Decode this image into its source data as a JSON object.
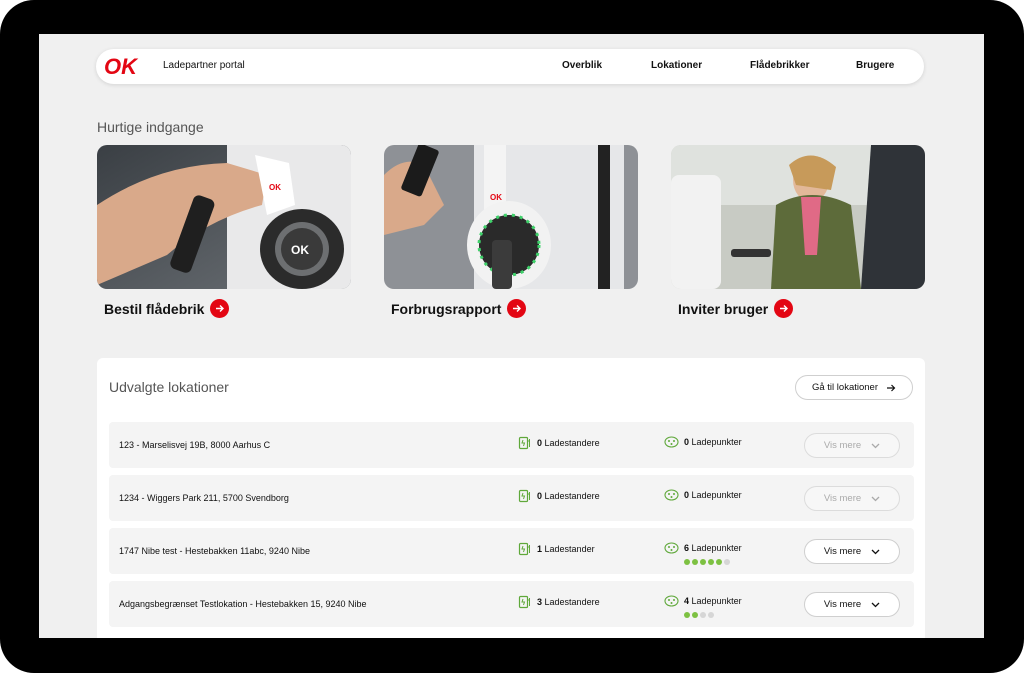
{
  "header": {
    "logo_text": "OK",
    "portal_name": "Ladepartner portal",
    "nav": [
      "Overblik",
      "Lokationer",
      "Flådebrikker",
      "Brugere"
    ]
  },
  "quick": {
    "heading": "Hurtige indgange",
    "cards": [
      {
        "label": "Bestil flådebrik"
      },
      {
        "label": "Forbrugsrapport"
      },
      {
        "label": "Inviter bruger"
      }
    ]
  },
  "locations": {
    "title": "Udvalgte lokationer",
    "goto_label": "Gå til lokationer",
    "rows": [
      {
        "name": "123 - Marselisvej 19B, 8000 Aarhus C",
        "chargers_count": "0",
        "chargers_label": "Ladestandere",
        "points_count": "0",
        "points_label": "Ladepunkter",
        "dots_on": 0,
        "dots_total": 0,
        "button": "Vis mere",
        "enabled": false
      },
      {
        "name": "1234 - Wiggers Park 211, 5700 Svendborg",
        "chargers_count": "0",
        "chargers_label": "Ladestandere",
        "points_count": "0",
        "points_label": "Ladepunkter",
        "dots_on": 0,
        "dots_total": 0,
        "button": "Vis mere",
        "enabled": false
      },
      {
        "name": "1747 Nibe test - Hestebakken 11abc, 9240 Nibe",
        "chargers_count": "1",
        "chargers_label": "Ladestander",
        "points_count": "6",
        "points_label": "Ladepunkter",
        "dots_on": 5,
        "dots_total": 6,
        "button": "Vis mere",
        "enabled": true
      },
      {
        "name": "Adgangsbegrænset Testlokation - Hestebakken 15, 9240 Nibe",
        "chargers_count": "3",
        "chargers_label": "Ladestandere",
        "points_count": "4",
        "points_label": "Ladepunkter",
        "dots_on": 2,
        "dots_total": 4,
        "button": "Vis mere",
        "enabled": true
      }
    ]
  },
  "colors": {
    "brand_red": "#e30613",
    "charger_green": "#5fa83a",
    "dot_green": "#7dc142"
  }
}
